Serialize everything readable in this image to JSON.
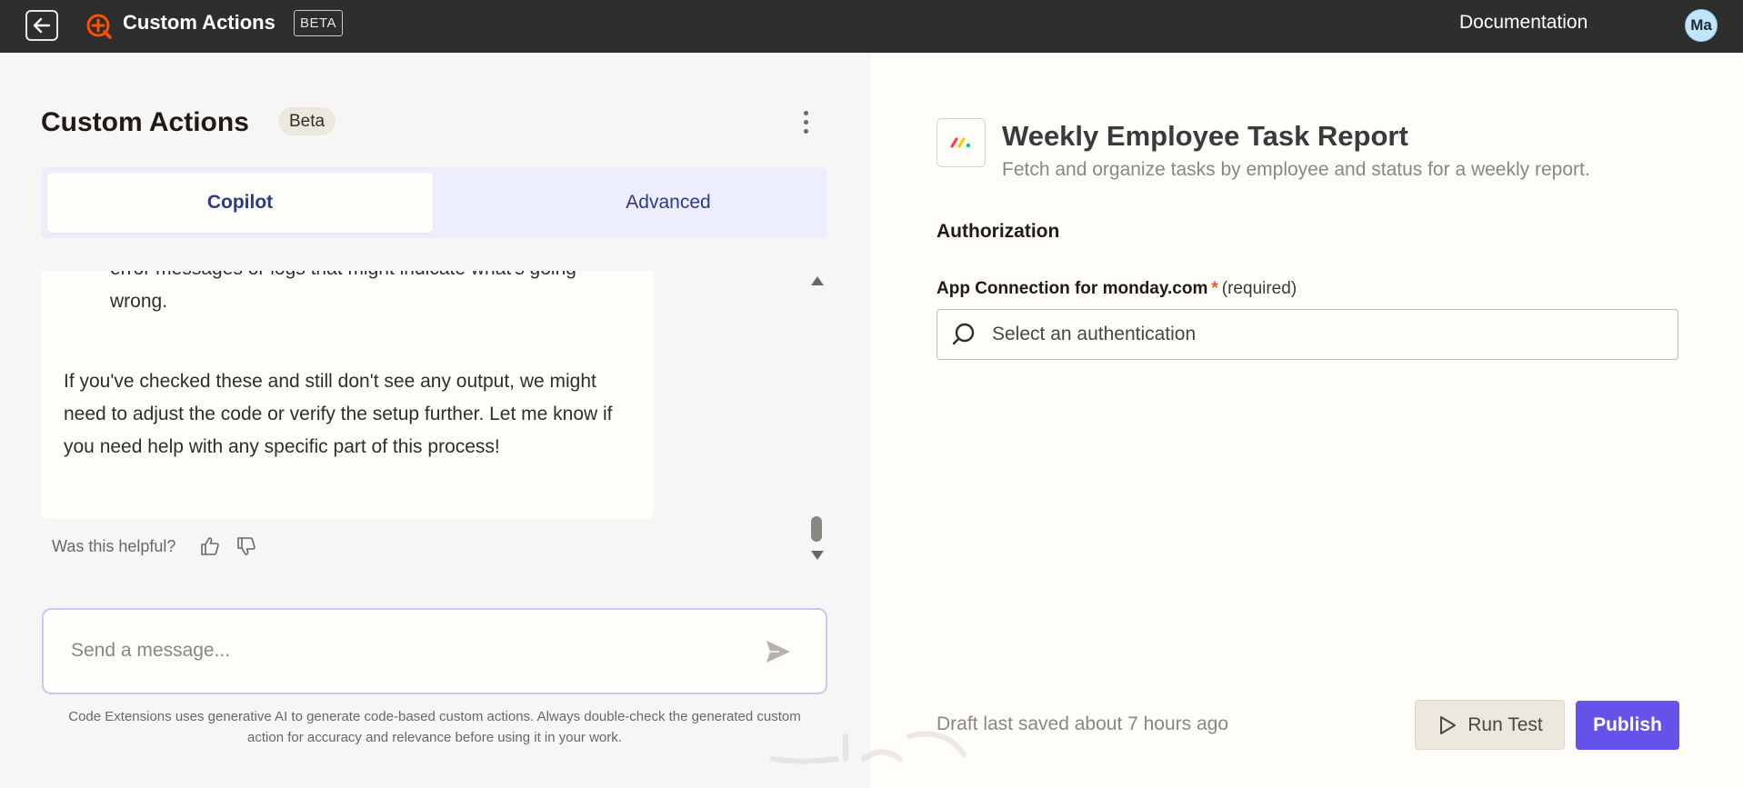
{
  "topbar": {
    "app_title": "Custom Actions",
    "beta_tag": "BETA",
    "documentation_label": "Documentation",
    "avatar_initials": "Ma"
  },
  "left_panel": {
    "title": "Custom Actions",
    "beta_pill": "Beta",
    "tabs": [
      {
        "label": "Copilot",
        "selected": true
      },
      {
        "label": "Advanced",
        "selected": false
      }
    ],
    "chat": {
      "list_item_partial": "error messages or logs that might indicate what's going wrong.",
      "paragraph": "If you've checked these and still don't see any output, we might need to adjust the code or verify the setup further. Let me know if you need help with any specific part of this process!",
      "helpful_label": "Was this helpful?"
    },
    "message_input": {
      "placeholder": "Send a message...",
      "value": ""
    },
    "disclaimer": "Code Extensions uses generative AI to generate code-based custom actions. Always double-check the generated custom action for accuracy and relevance before using it in your work."
  },
  "right_panel": {
    "action_title": "Weekly Employee Task Report",
    "action_description": "Fetch and organize tasks by employee and status for a weekly report.",
    "authorization_heading": "Authorization",
    "field": {
      "label_bold": "App Connection for monday.com",
      "required_star": "*",
      "required_text": "(required)",
      "placeholder": "Select an authentication"
    },
    "draft_status": "Draft last saved about 7 hours ago",
    "run_test_label": "Run Test",
    "publish_label": "Publish"
  },
  "colors": {
    "topbar_bg": "#2d2e2e",
    "brand_orange": "#ff4f00",
    "publish_purple": "#6552e8",
    "tab_text": "#2b3a8a"
  },
  "icons": [
    "back-arrow-icon",
    "custom-actions-icon",
    "kebab-menu-icon",
    "thumbs-up-icon",
    "thumbs-down-icon",
    "send-icon",
    "monday-logo-icon",
    "search-icon",
    "play-icon"
  ]
}
